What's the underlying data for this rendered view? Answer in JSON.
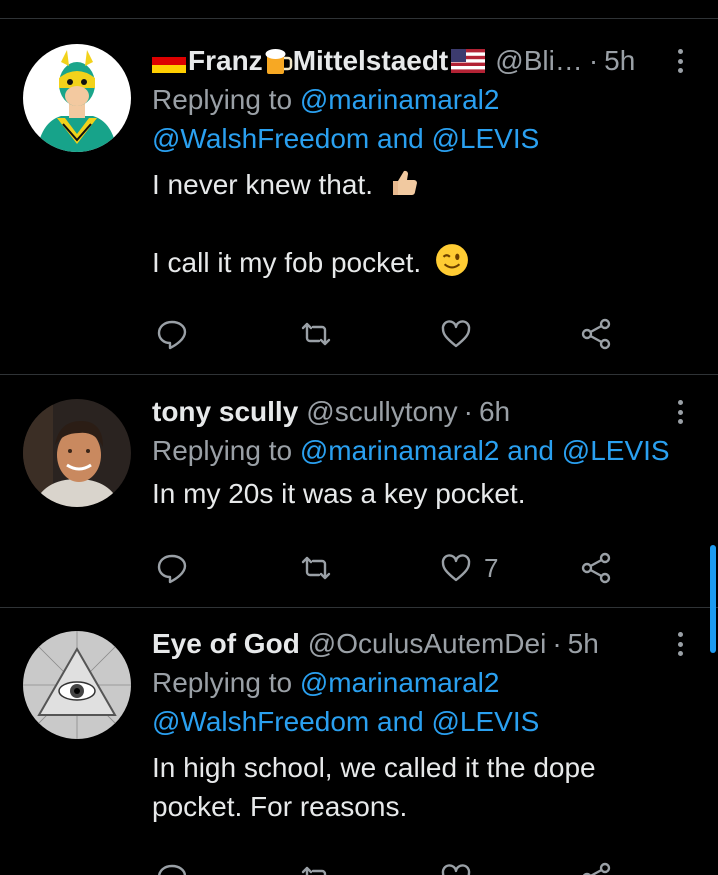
{
  "tweets": [
    {
      "name_part1": "Franz",
      "name_part2": "Mittelstaedt",
      "handle": "@Bli…",
      "time": "5h",
      "replying_prefix": "Replying to ",
      "replying_line1_mention": "@marinamaral2",
      "replying_line2_mention1": "@WalshFreedom",
      "replying_and": " and ",
      "replying_line2_mention2": "@LEVIS",
      "text_line1": "I never knew that.",
      "text_line2": "I call it my fob pocket.",
      "like_count": ""
    },
    {
      "name": "tony scully",
      "handle": "@scullytony",
      "time": "6h",
      "replying_prefix": "Replying to ",
      "replying_mention1": "@marinamaral2",
      "replying_and": " and ",
      "replying_mention2": "@LEVIS",
      "text": "In my 20s it was a key pocket.",
      "like_count": "7"
    },
    {
      "name": "Eye of God",
      "handle": "@OculusAutemDei",
      "time": "5h",
      "replying_prefix": "Replying to ",
      "replying_line1_mention": "@marinamaral2",
      "replying_line2_mention1": "@WalshFreedom",
      "replying_and": " and ",
      "replying_line2_mention2": "@LEVIS",
      "text_line1": "In high school, we called it the dope",
      "text_line2": "pocket. For reasons."
    }
  ],
  "dot": "·",
  "colors": {
    "background": "#000000",
    "text": "#e7e9ea",
    "muted": "#9aa0a6",
    "link": "#2aa0f0",
    "divider": "#2f3336"
  },
  "icons": [
    "reply-icon",
    "retweet-icon",
    "like-icon",
    "share-icon",
    "more-icon"
  ]
}
